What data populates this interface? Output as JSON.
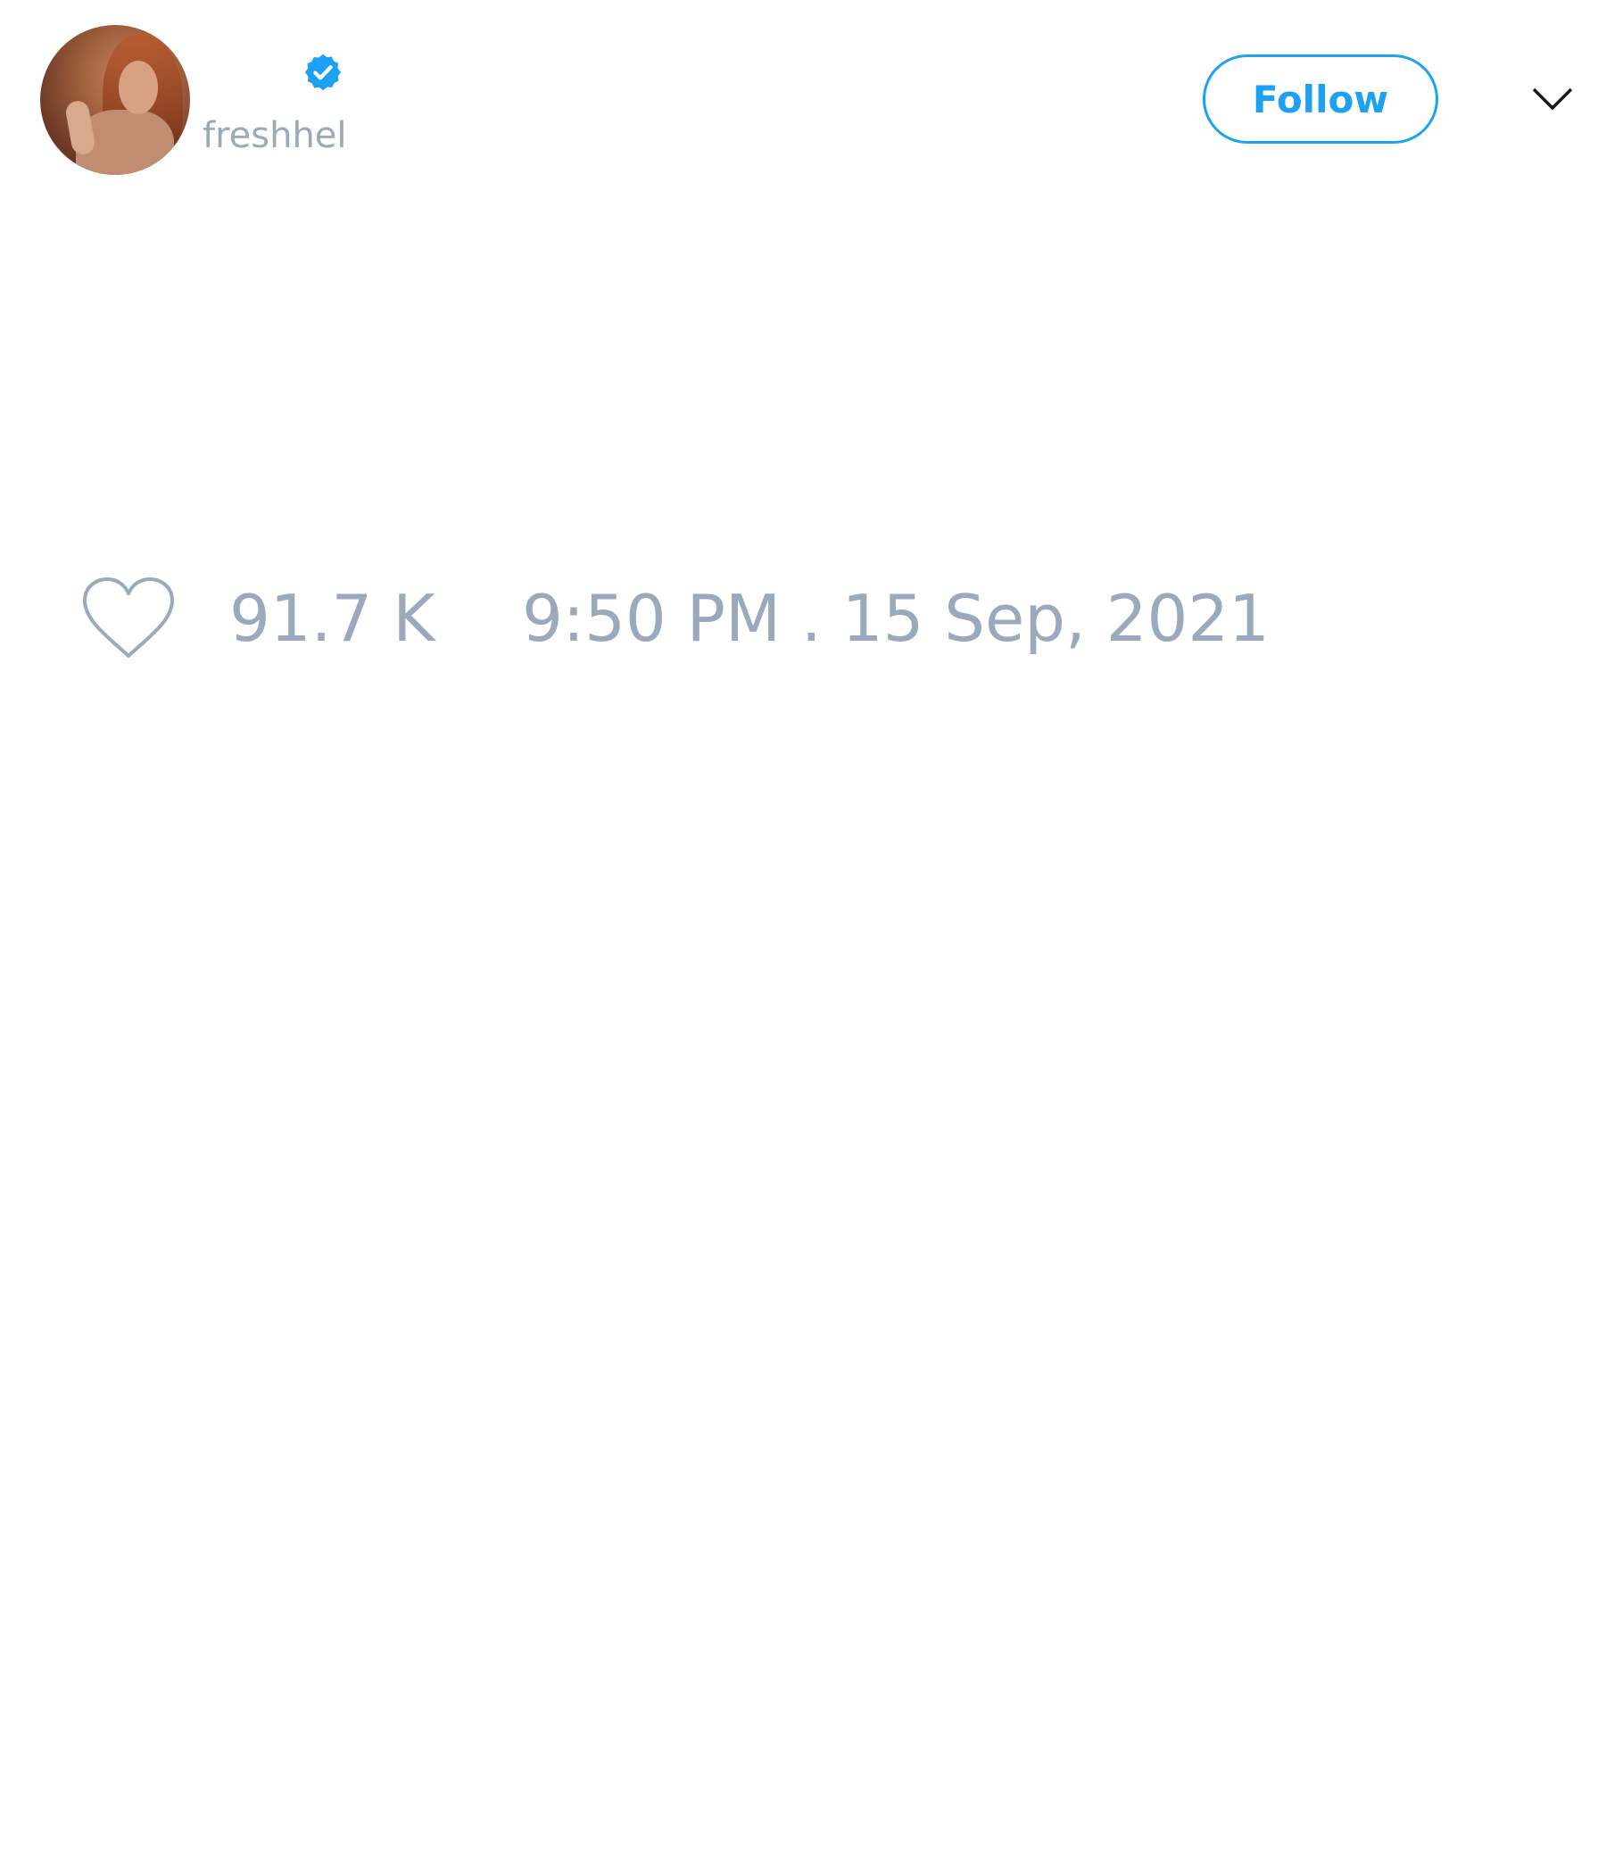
{
  "user": {
    "handle": "freshhel",
    "verified": true,
    "avatar": "profile-photo"
  },
  "header": {
    "follow_label": "Follow",
    "menu_icon": "chevron-down-icon"
  },
  "tweet": {
    "like_icon": "heart-outline-icon",
    "likes": "91.7 K",
    "timestamp": "9:50 PM . 15 Sep, 2021"
  },
  "colors": {
    "accent": "#1da1f2",
    "muted_text": "#9aa9bc",
    "background": "#ffffff"
  }
}
